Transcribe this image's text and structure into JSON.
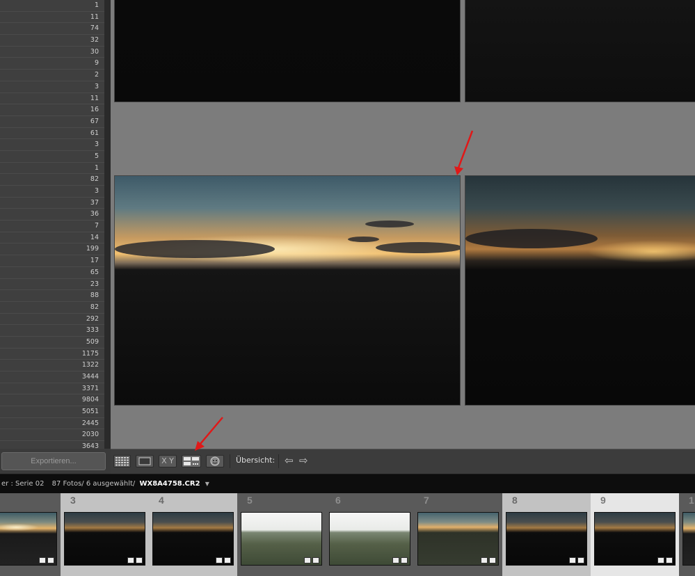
{
  "left_panel": {
    "counts": [
      "1",
      "11",
      "74",
      "32",
      "30",
      "9",
      "2",
      "3",
      "11",
      "16",
      "67",
      "61",
      "3",
      "5",
      "1",
      "82",
      "3",
      "37",
      "36",
      "7",
      "14",
      "199",
      "17",
      "65",
      "23",
      "88",
      "82",
      "292",
      "333",
      "509",
      "1175",
      "1322",
      "3444",
      "3371",
      "9804",
      "5051",
      "2445",
      "2030",
      "3643"
    ],
    "export_button": "Exportieren..."
  },
  "toolbar": {
    "buttons": [
      {
        "name": "grid-view",
        "icon": "grid-icon"
      },
      {
        "name": "loupe-view",
        "icon": "loupe-icon"
      },
      {
        "name": "compare-view",
        "label": "X Y"
      },
      {
        "name": "survey-view",
        "icon": "survey-icon"
      },
      {
        "name": "people-view",
        "icon": "face-icon"
      }
    ],
    "overview_label": "Übersicht:"
  },
  "status_bar": {
    "folder": "er : Serie 02",
    "info": "87 Fotos/ 6 ausgewählt/",
    "filename": "WX8A4758.CR2"
  },
  "filmstrip": {
    "cells": [
      {
        "number": "",
        "thumb": "sunset",
        "selected": false
      },
      {
        "number": "3",
        "thumb": "sunset-dark",
        "selected": true
      },
      {
        "number": "4",
        "thumb": "sunset-dark",
        "selected": true
      },
      {
        "number": "5",
        "thumb": "bright",
        "selected": false
      },
      {
        "number": "6",
        "thumb": "bright",
        "selected": false
      },
      {
        "number": "7",
        "thumb": "sunset-light",
        "selected": false
      },
      {
        "number": "8",
        "thumb": "sunset-dark",
        "selected": true
      },
      {
        "number": "9",
        "thumb": "sunset-dark",
        "selected": true
      },
      {
        "number": "1",
        "thumb": "sunset",
        "selected": false
      }
    ]
  },
  "colors": {
    "panel_bg": "#3f3f3f",
    "grid_bg": "#7c7c7c",
    "selected_cell": "#c2c2c2",
    "active_cell": "#e6e6e6",
    "annotation_arrow": "#e01818"
  }
}
